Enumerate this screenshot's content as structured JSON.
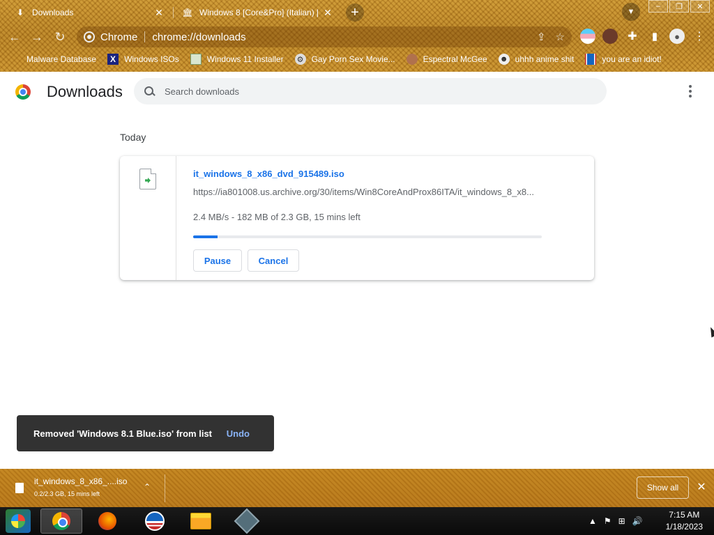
{
  "browser": {
    "tabs": [
      {
        "label": "Downloads",
        "icon": "download-icon",
        "active": true
      },
      {
        "label": "Windows 8 [Core&Pro] (Italian) [",
        "icon": "archive-icon",
        "active": false
      }
    ],
    "new_tab_label": "+",
    "omnibox": {
      "site_name": "Chrome",
      "url": "chrome://downloads"
    },
    "bookmarks": [
      {
        "label": "Malware Database",
        "icon": "blank-icon"
      },
      {
        "label": "Windows ISOs",
        "icon": "x-logo-icon"
      },
      {
        "label": "Windows 11 Installer",
        "icon": "image-icon"
      },
      {
        "label": "Gay Porn Sex Movie...",
        "icon": "gear-icon"
      },
      {
        "label": "Espectral McGee",
        "icon": "face-icon"
      },
      {
        "label": "uhhh anime shit",
        "icon": "anime-icon"
      },
      {
        "label": "you are an idiot!",
        "icon": "uk-flag-icon"
      }
    ],
    "theme_color": "#c08a24"
  },
  "page": {
    "title": "Downloads",
    "search_placeholder": "Search downloads",
    "section_date": "Today",
    "download": {
      "file_name": "it_windows_8_x86_dvd_915489.iso",
      "url": "https://ia801008.us.archive.org/30/items/Win8CoreAndProx86ITA/it_windows_8_x8...",
      "status": "2.4 MB/s - 182 MB of 2.3 GB, 15 mins left",
      "progress_fraction": 0.07,
      "pause_label": "Pause",
      "cancel_label": "Cancel"
    },
    "toast": {
      "message": "Removed 'Windows 8.1 Blue.iso' from list",
      "action": "Undo"
    },
    "accent_color": "#1a73e8"
  },
  "shelf": {
    "file_name": "it_windows_8_x86_....iso",
    "status": "0.2/2.3 GB, 15 mins left",
    "show_all_label": "Show all"
  },
  "taskbar": {
    "apps": [
      "chrome",
      "firefox",
      "obama",
      "file-explorer",
      "virtualbox"
    ],
    "time": "7:15 AM",
    "date": "1/18/2023"
  }
}
